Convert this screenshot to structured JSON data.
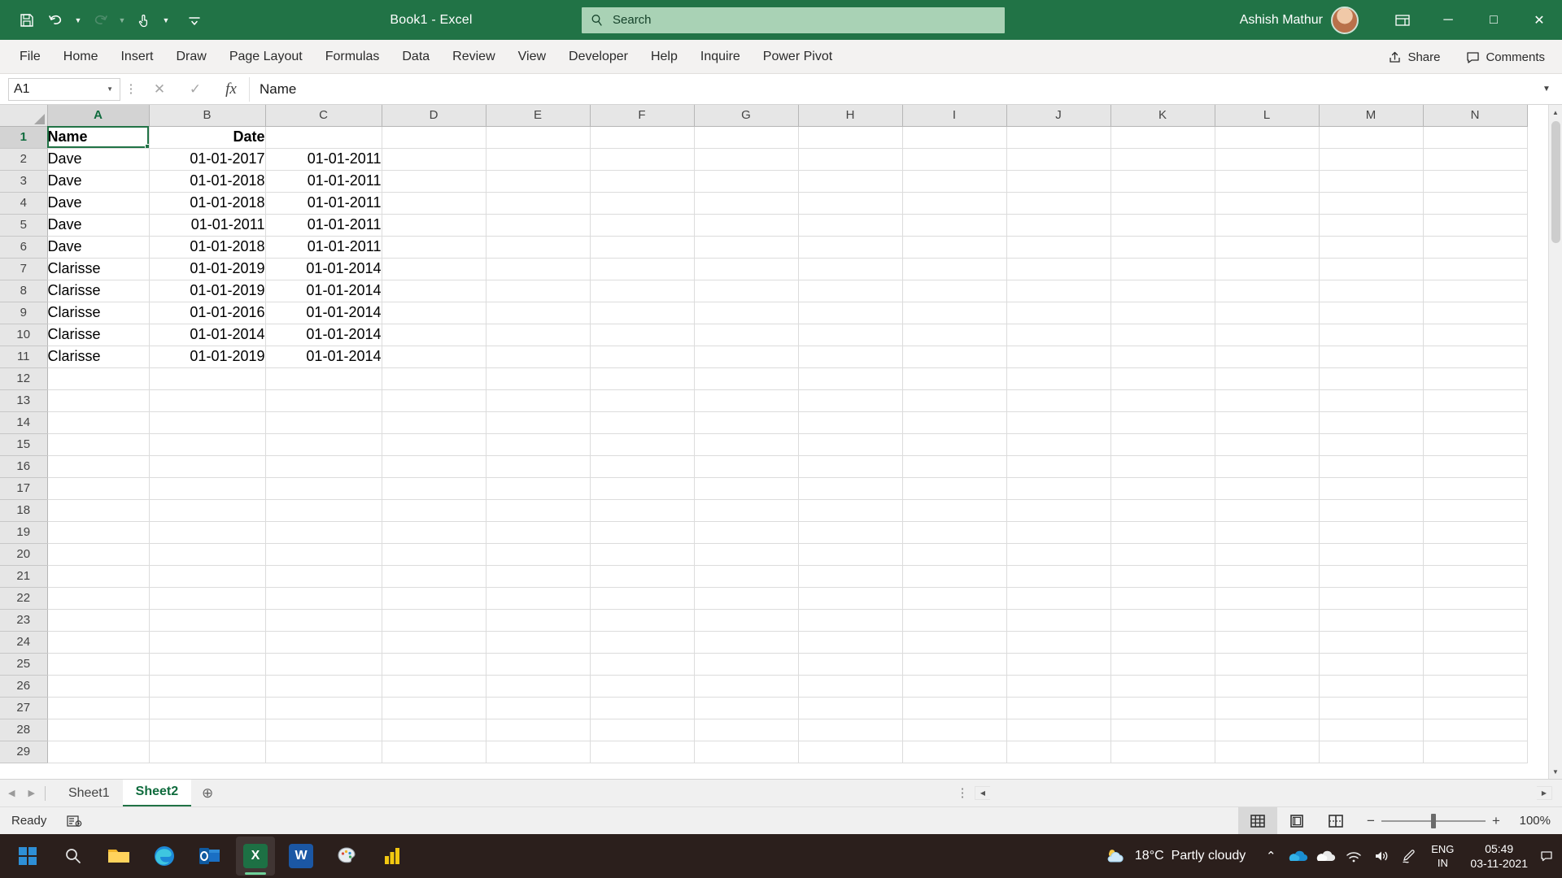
{
  "titlebar": {
    "app_title": "Book1  -  Excel",
    "quick_access": [
      {
        "name": "save-icon",
        "label": "Save"
      },
      {
        "name": "undo-icon",
        "label": "Undo"
      },
      {
        "name": "redo-icon",
        "label": "Redo"
      },
      {
        "name": "touch-mode-icon",
        "label": "Touch/Mouse Mode"
      },
      {
        "name": "customize-qat-icon",
        "label": "Customize Quick Access Toolbar"
      }
    ],
    "search_placeholder": "Search",
    "search_icon": "search-icon",
    "user_name": "Ashish Mathur",
    "ribbon_display_icon": "ribbon-display-options-icon",
    "minimize_label": "─",
    "maximize_label": "□",
    "close_label": "✕",
    "accent_color": "#217346",
    "search_bg": "#a9d2b5"
  },
  "ribbon": {
    "tabs": [
      {
        "label": "File",
        "active": false
      },
      {
        "label": "Home",
        "active": false
      },
      {
        "label": "Insert",
        "active": false
      },
      {
        "label": "Draw",
        "active": false
      },
      {
        "label": "Page Layout",
        "active": false
      },
      {
        "label": "Formulas",
        "active": false
      },
      {
        "label": "Data",
        "active": false
      },
      {
        "label": "Review",
        "active": false
      },
      {
        "label": "View",
        "active": false
      },
      {
        "label": "Developer",
        "active": false
      },
      {
        "label": "Help",
        "active": false
      },
      {
        "label": "Inquire",
        "active": false
      },
      {
        "label": "Power Pivot",
        "active": false
      }
    ],
    "share_label": "Share",
    "comments_label": "Comments"
  },
  "formula_bar": {
    "name_box_value": "A1",
    "cancel_icon": "cancel-icon",
    "enter_icon": "enter-icon",
    "function_icon": "insert-function-icon",
    "formula_value": "Name",
    "expand_icon": "expand-formula-bar-icon"
  },
  "grid": {
    "columns": [
      "A",
      "B",
      "C",
      "D",
      "E",
      "F",
      "G",
      "H",
      "I",
      "J",
      "K",
      "L",
      "M",
      "N"
    ],
    "selected_column": "A",
    "selected_row": 1,
    "selected_cell": "A1",
    "rows": [
      {
        "num": 1,
        "cells": [
          "Name",
          "Date",
          "",
          "",
          "",
          "",
          "",
          "",
          "",
          "",
          "",
          "",
          "",
          ""
        ],
        "bold": true
      },
      {
        "num": 2,
        "cells": [
          "Dave",
          "01-01-2017",
          "01-01-2011",
          "",
          "",
          "",
          "",
          "",
          "",
          "",
          "",
          "",
          "",
          ""
        ],
        "bold": false
      },
      {
        "num": 3,
        "cells": [
          "Dave",
          "01-01-2018",
          "01-01-2011",
          "",
          "",
          "",
          "",
          "",
          "",
          "",
          "",
          "",
          "",
          ""
        ],
        "bold": false
      },
      {
        "num": 4,
        "cells": [
          "Dave",
          "01-01-2018",
          "01-01-2011",
          "",
          "",
          "",
          "",
          "",
          "",
          "",
          "",
          "",
          "",
          ""
        ],
        "bold": false
      },
      {
        "num": 5,
        "cells": [
          "Dave",
          "01-01-2011",
          "01-01-2011",
          "",
          "",
          "",
          "",
          "",
          "",
          "",
          "",
          "",
          "",
          ""
        ],
        "bold": false
      },
      {
        "num": 6,
        "cells": [
          "Dave",
          "01-01-2018",
          "01-01-2011",
          "",
          "",
          "",
          "",
          "",
          "",
          "",
          "",
          "",
          "",
          ""
        ],
        "bold": false
      },
      {
        "num": 7,
        "cells": [
          "Clarisse",
          "01-01-2019",
          "01-01-2014",
          "",
          "",
          "",
          "",
          "",
          "",
          "",
          "",
          "",
          "",
          ""
        ],
        "bold": false
      },
      {
        "num": 8,
        "cells": [
          "Clarisse",
          "01-01-2019",
          "01-01-2014",
          "",
          "",
          "",
          "",
          "",
          "",
          "",
          "",
          "",
          "",
          ""
        ],
        "bold": false
      },
      {
        "num": 9,
        "cells": [
          "Clarisse",
          "01-01-2016",
          "01-01-2014",
          "",
          "",
          "",
          "",
          "",
          "",
          "",
          "",
          "",
          "",
          ""
        ],
        "bold": false
      },
      {
        "num": 10,
        "cells": [
          "Clarisse",
          "01-01-2014",
          "01-01-2014",
          "",
          "",
          "",
          "",
          "",
          "",
          "",
          "",
          "",
          "",
          ""
        ],
        "bold": false
      },
      {
        "num": 11,
        "cells": [
          "Clarisse",
          "01-01-2019",
          "01-01-2014",
          "",
          "",
          "",
          "",
          "",
          "",
          "",
          "",
          "",
          "",
          ""
        ],
        "bold": false
      },
      {
        "num": 12,
        "cells": [
          "",
          "",
          "",
          "",
          "",
          "",
          "",
          "",
          "",
          "",
          "",
          "",
          "",
          ""
        ],
        "bold": false
      },
      {
        "num": 13,
        "cells": [
          "",
          "",
          "",
          "",
          "",
          "",
          "",
          "",
          "",
          "",
          "",
          "",
          "",
          ""
        ],
        "bold": false
      },
      {
        "num": 14,
        "cells": [
          "",
          "",
          "",
          "",
          "",
          "",
          "",
          "",
          "",
          "",
          "",
          "",
          "",
          ""
        ],
        "bold": false
      },
      {
        "num": 15,
        "cells": [
          "",
          "",
          "",
          "",
          "",
          "",
          "",
          "",
          "",
          "",
          "",
          "",
          "",
          ""
        ],
        "bold": false
      },
      {
        "num": 16,
        "cells": [
          "",
          "",
          "",
          "",
          "",
          "",
          "",
          "",
          "",
          "",
          "",
          "",
          "",
          ""
        ],
        "bold": false
      },
      {
        "num": 17,
        "cells": [
          "",
          "",
          "",
          "",
          "",
          "",
          "",
          "",
          "",
          "",
          "",
          "",
          "",
          ""
        ],
        "bold": false
      },
      {
        "num": 18,
        "cells": [
          "",
          "",
          "",
          "",
          "",
          "",
          "",
          "",
          "",
          "",
          "",
          "",
          "",
          ""
        ],
        "bold": false
      },
      {
        "num": 19,
        "cells": [
          "",
          "",
          "",
          "",
          "",
          "",
          "",
          "",
          "",
          "",
          "",
          "",
          "",
          ""
        ],
        "bold": false
      },
      {
        "num": 20,
        "cells": [
          "",
          "",
          "",
          "",
          "",
          "",
          "",
          "",
          "",
          "",
          "",
          "",
          "",
          ""
        ],
        "bold": false
      },
      {
        "num": 21,
        "cells": [
          "",
          "",
          "",
          "",
          "",
          "",
          "",
          "",
          "",
          "",
          "",
          "",
          "",
          ""
        ],
        "bold": false
      },
      {
        "num": 22,
        "cells": [
          "",
          "",
          "",
          "",
          "",
          "",
          "",
          "",
          "",
          "",
          "",
          "",
          "",
          ""
        ],
        "bold": false
      },
      {
        "num": 23,
        "cells": [
          "",
          "",
          "",
          "",
          "",
          "",
          "",
          "",
          "",
          "",
          "",
          "",
          "",
          ""
        ],
        "bold": false
      },
      {
        "num": 24,
        "cells": [
          "",
          "",
          "",
          "",
          "",
          "",
          "",
          "",
          "",
          "",
          "",
          "",
          "",
          ""
        ],
        "bold": false
      },
      {
        "num": 25,
        "cells": [
          "",
          "",
          "",
          "",
          "",
          "",
          "",
          "",
          "",
          "",
          "",
          "",
          "",
          ""
        ],
        "bold": false
      },
      {
        "num": 26,
        "cells": [
          "",
          "",
          "",
          "",
          "",
          "",
          "",
          "",
          "",
          "",
          "",
          "",
          "",
          ""
        ],
        "bold": false
      },
      {
        "num": 27,
        "cells": [
          "",
          "",
          "",
          "",
          "",
          "",
          "",
          "",
          "",
          "",
          "",
          "",
          "",
          ""
        ],
        "bold": false
      },
      {
        "num": 28,
        "cells": [
          "",
          "",
          "",
          "",
          "",
          "",
          "",
          "",
          "",
          "",
          "",
          "",
          "",
          ""
        ],
        "bold": false
      },
      {
        "num": 29,
        "cells": [
          "",
          "",
          "",
          "",
          "",
          "",
          "",
          "",
          "",
          "",
          "",
          "",
          "",
          ""
        ],
        "bold": false
      }
    ]
  },
  "sheet_tabs": {
    "prev_label": "◀",
    "next_label": "▶",
    "tabs": [
      {
        "label": "Sheet1",
        "active": false
      },
      {
        "label": "Sheet2",
        "active": true
      }
    ],
    "add_label": "⊕"
  },
  "status_bar": {
    "status_text": "Ready",
    "accessibility_icon": "accessibility-checker-icon",
    "views": [
      {
        "name": "normal-view-icon",
        "active": true
      },
      {
        "name": "page-layout-view-icon",
        "active": false
      },
      {
        "name": "page-break-preview-icon",
        "active": false
      }
    ],
    "zoom_out_label": "−",
    "zoom_in_label": "+",
    "zoom_level": "100%"
  },
  "taskbar": {
    "items": [
      {
        "name": "start-icon",
        "label": "Start"
      },
      {
        "name": "search-icon",
        "label": "Search"
      },
      {
        "name": "file-explorer-icon",
        "label": "File Explorer"
      },
      {
        "name": "microsoft-edge-icon",
        "label": "Microsoft Edge"
      },
      {
        "name": "outlook-icon",
        "label": "Outlook"
      },
      {
        "name": "excel-icon",
        "label": "Excel"
      },
      {
        "name": "word-icon",
        "label": "Word"
      },
      {
        "name": "paint-icon",
        "label": "Paint"
      },
      {
        "name": "powerbi-icon",
        "label": "Power BI"
      }
    ],
    "weather_temp": "18°C",
    "weather_desc": "Partly cloudy",
    "tray_expand_label": "⌃",
    "tray_icons": [
      "onedrive-icon",
      "onedrive-personal-icon",
      "network-icon",
      "volume-icon",
      "pen-icon"
    ],
    "lang_line1": "ENG",
    "lang_line2": "IN",
    "clock_time": "05:49",
    "clock_date": "03-11-2021",
    "notifications_icon": "notifications-icon"
  }
}
